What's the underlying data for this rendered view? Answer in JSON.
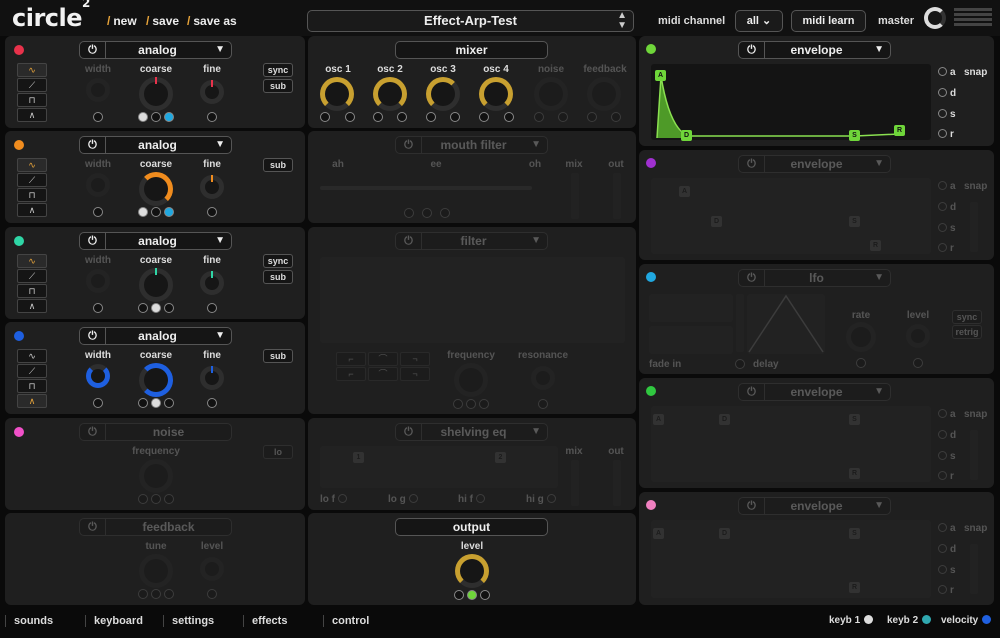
{
  "app": {
    "logo": "circle",
    "logo_sup": "2"
  },
  "top": {
    "new": "new",
    "save": "save",
    "save_as": "save as",
    "preset": "Effect-Arp-Test",
    "midi_channel_label": "midi channel",
    "midi_channel_value": "all",
    "midi_learn": "midi learn",
    "master": "master"
  },
  "colors": {
    "accent": "#e8a43a",
    "green": "#6fd63a",
    "red": "#e8324b",
    "orange": "#f08c1e",
    "teal": "#2fd6a6",
    "blue": "#1e5fe0",
    "pink": "#f050c8",
    "purple": "#a030d0",
    "cyan": "#20a8e0",
    "lime": "#30c840",
    "rose": "#f080c0"
  },
  "osc": [
    {
      "title": "analog",
      "width": "width",
      "coarse": "coarse",
      "fine": "fine",
      "b1": "sync",
      "b2": "sub"
    },
    {
      "title": "analog",
      "width": "width",
      "coarse": "coarse",
      "fine": "fine",
      "b1": "sub"
    },
    {
      "title": "analog",
      "width": "width",
      "coarse": "coarse",
      "fine": "fine",
      "b1": "sync",
      "b2": "sub"
    },
    {
      "title": "analog",
      "width": "width",
      "coarse": "coarse",
      "fine": "fine",
      "b1": "sub"
    }
  ],
  "noise": {
    "title": "noise",
    "frequency": "frequency",
    "lo": "lo"
  },
  "feedback": {
    "title": "feedback",
    "tune": "tune",
    "level": "level"
  },
  "mixer": {
    "title": "mixer",
    "osc1": "osc 1",
    "osc2": "osc 2",
    "osc3": "osc 3",
    "osc4": "osc 4",
    "noise": "noise",
    "feedback": "feedback"
  },
  "mouth": {
    "title": "mouth filter",
    "v1": "ah",
    "v2": "ee",
    "v3": "oh",
    "mix": "mix",
    "out": "out"
  },
  "filter": {
    "title": "filter",
    "frequency": "frequency",
    "resonance": "resonance"
  },
  "eq": {
    "title": "shelving eq",
    "n1": "1",
    "n2": "2",
    "mix": "mix",
    "out": "out",
    "lof": "lo f",
    "log": "lo g",
    "hif": "hi f",
    "hig": "hi g"
  },
  "output": {
    "title": "output",
    "level": "level"
  },
  "env1": {
    "title": "envelope",
    "a": "a",
    "d": "d",
    "s": "s",
    "r": "r",
    "snap": "snap",
    "nA": "A",
    "nD": "D",
    "nS": "S",
    "nR": "R"
  },
  "env2": {
    "title": "envelope",
    "a": "a",
    "d": "d",
    "s": "s",
    "r": "r",
    "snap": "snap",
    "nA": "A",
    "nD": "D",
    "nS": "S",
    "nR": "R"
  },
  "lfo": {
    "title": "lfo",
    "rate": "rate",
    "level": "level",
    "fade_in": "fade in",
    "delay": "delay",
    "sync": "sync",
    "retrig": "retrig"
  },
  "env3": {
    "title": "envelope",
    "a": "a",
    "d": "d",
    "s": "s",
    "r": "r",
    "snap": "snap",
    "nA": "A",
    "nD": "D",
    "nS": "S",
    "nR": "R"
  },
  "env4": {
    "title": "envelope",
    "a": "a",
    "d": "d",
    "s": "s",
    "r": "r",
    "snap": "snap",
    "nA": "A",
    "nD": "D",
    "nS": "S",
    "nR": "R"
  },
  "bottom": {
    "sounds": "sounds",
    "keyboard": "keyboard",
    "settings": "settings",
    "effects": "effects",
    "control": "control",
    "keyb1": "keyb 1",
    "keyb2": "keyb 2",
    "velocity": "velocity"
  }
}
